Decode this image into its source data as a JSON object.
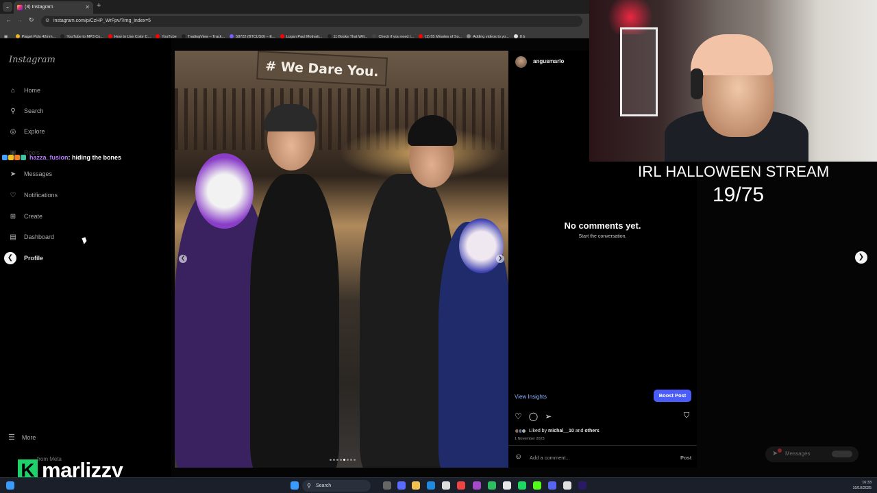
{
  "browser": {
    "tab_title": "(3) Instagram",
    "url": "instagram.com/p/CzHP_WrFpv/?img_index=5",
    "bookmarks": [
      {
        "label": "Piaget Polo 42mm...",
        "color": "#e6b422"
      },
      {
        "label": "YouTube to MP3 Co...",
        "color": "#222222"
      },
      {
        "label": "How to Use Color C...",
        "color": "#ff0000"
      },
      {
        "label": "YouTube",
        "color": "#ff0000"
      },
      {
        "label": "TradingView – Track...",
        "color": "#222222"
      },
      {
        "label": "58722 (BTCUSD) – E...",
        "color": "#7a5cff"
      },
      {
        "label": "Logan Paul Motivati...",
        "color": "#ff0000"
      },
      {
        "label": "11 Books That Will...",
        "color": "#222222"
      },
      {
        "label": "Check if you need t...",
        "color": "#444444"
      },
      {
        "label": "(1) 55 Minutes of So...",
        "color": "#ff0000"
      },
      {
        "label": "Adding videos to yo...",
        "color": "#888888"
      },
      {
        "label": "8 b",
        "color": "#e0e0e0"
      }
    ]
  },
  "sidebar": {
    "logo": "Instagram",
    "items": [
      {
        "label": "Home",
        "icon": "home-icon",
        "glyph": "⌂"
      },
      {
        "label": "Search",
        "icon": "search-icon",
        "glyph": "⚲"
      },
      {
        "label": "Explore",
        "icon": "explore-icon",
        "glyph": "◎"
      },
      {
        "label": "Reels",
        "icon": "reels-icon",
        "glyph": "▣"
      },
      {
        "label": "Messages",
        "icon": "messages-icon",
        "glyph": "➤"
      },
      {
        "label": "Notifications",
        "icon": "heart-icon",
        "glyph": "♡"
      },
      {
        "label": "Create",
        "icon": "create-icon",
        "glyph": "⊞"
      },
      {
        "label": "Dashboard",
        "icon": "dashboard-icon",
        "glyph": "▤"
      },
      {
        "label": "Profile",
        "icon": "profile-icon",
        "glyph": "●"
      }
    ],
    "more": "More",
    "meta": "from Meta"
  },
  "chat": {
    "user": "hazza_fusion",
    "message": ": hiding the bones"
  },
  "post": {
    "sign_text": "# We Dare You.",
    "carousel_dots": 8,
    "carousel_active": 5
  },
  "panel": {
    "username": "angusmarlo",
    "no_comments": "No comments yet.",
    "start_conversation": "Start the conversation.",
    "view_insights": "View Insights",
    "boost_post": "Boost Post",
    "liked_prefix": "Liked by ",
    "liked_user": "michal__10",
    "liked_and": " and ",
    "liked_others": "others",
    "date": "1 November 2023",
    "add_comment": "Add a comment...",
    "post_button": "Post"
  },
  "messages_pill": "Messages",
  "overlay": {
    "title": "IRL HALLOWEEN STREAM",
    "count": "19/75",
    "streamer": "marlizzy",
    "brand_letter": "K"
  },
  "taskbar": {
    "search": "Search",
    "time": "16:33",
    "date": "10/10/2025"
  }
}
